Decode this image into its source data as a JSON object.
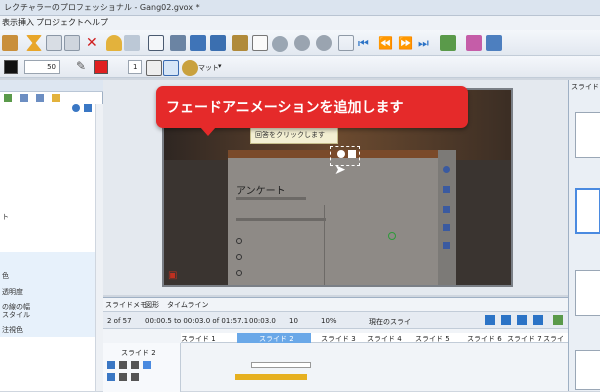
{
  "window": {
    "title": "レクチャラーのプロフェッショナル - Gang02.gvox *"
  },
  "menu": {
    "items": [
      "表示",
      "挿入",
      "プロジェクト",
      "ヘルプ"
    ]
  },
  "toolbar2": {
    "font_size": "50",
    "line_width": "1",
    "matte_label": "マット",
    "colors": {
      "black": "#111111",
      "red": "#e02020"
    }
  },
  "callout": {
    "text": "フェードアニメーションを追加します",
    "color": "#e52a2a"
  },
  "slide": {
    "tooltip": "回答をクリックします",
    "survey_title": "アンケート"
  },
  "left_panel": {
    "items": [
      "ト",
      "色",
      "透明度",
      "の線の幅",
      "スタイル",
      "注視色"
    ]
  },
  "right_panel": {
    "header": "スライド"
  },
  "timeline": {
    "tabs": [
      "スライドメモ",
      "図形",
      "タイムライン"
    ],
    "slide_counter": "2 of 57",
    "time_code": "00:00.5 to 00:03.0 of 01:57.1",
    "duration": "00:03.0",
    "zoom": "10",
    "percent": "10%",
    "current_slide_btn": "現在のスライ",
    "ruler": [
      "スライド 1",
      "スライド 2",
      "スライド 3",
      "スライド 4",
      "スライド 5",
      "スライド 6",
      "スライド 7",
      "スライ"
    ],
    "track_label": "スライド 2",
    "accent": "#6aa8e8"
  }
}
